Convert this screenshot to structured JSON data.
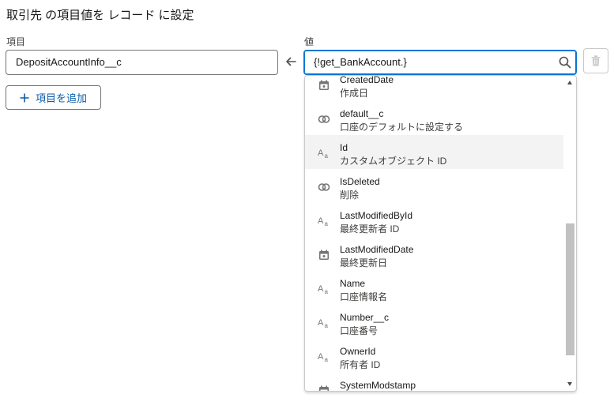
{
  "heading": "取引先 の項目値を レコード に設定",
  "field_label": "項目",
  "field_value": "DepositAccountInfo__c",
  "value_label": "値",
  "value_input": "{!get_BankAccount.}",
  "add_button_label": "項目を追加",
  "icons": {
    "arrow": "arrow-left-icon",
    "search": "search-icon",
    "delete": "trash-icon",
    "add": "plus-icon"
  },
  "colors": {
    "accent": "#0176d3",
    "link": "#0b5cab",
    "highlight": "#f3f3f3"
  },
  "dropdown": {
    "items": [
      {
        "api": "CreatedDate",
        "label": "作成日",
        "icon": "date"
      },
      {
        "api": "default__c",
        "label": "口座のデフォルトに設定する",
        "icon": "boolean"
      },
      {
        "api": "Id",
        "label": "カスタムオブジェクト ID",
        "icon": "text"
      },
      {
        "api": "IsDeleted",
        "label": "削除",
        "icon": "boolean"
      },
      {
        "api": "LastModifiedById",
        "label": "最終更新者 ID",
        "icon": "text"
      },
      {
        "api": "LastModifiedDate",
        "label": "最終更新日",
        "icon": "date"
      },
      {
        "api": "Name",
        "label": "口座情報名",
        "icon": "text"
      },
      {
        "api": "Number__c",
        "label": "口座番号",
        "icon": "text"
      },
      {
        "api": "OwnerId",
        "label": "所有者 ID",
        "icon": "text"
      },
      {
        "api": "SystemModstamp",
        "label": "",
        "icon": "date"
      }
    ],
    "highlighted_index": 2
  }
}
